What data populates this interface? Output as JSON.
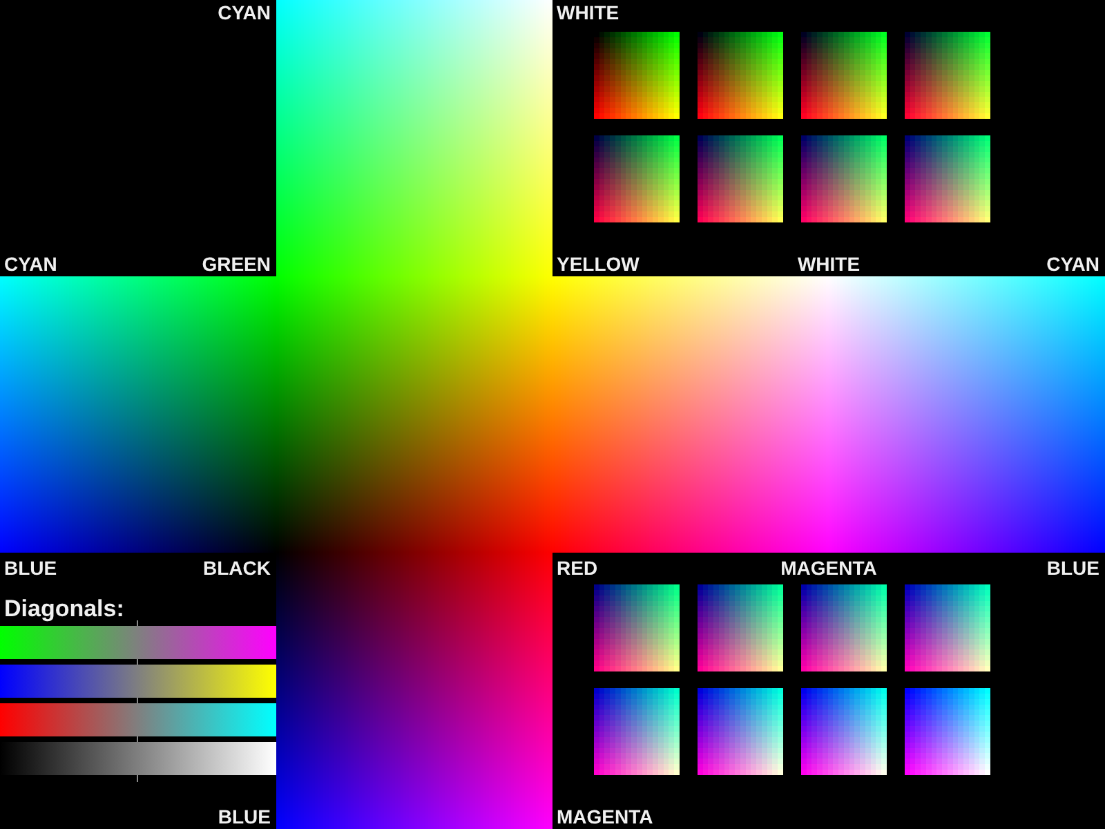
{
  "top_left_corner": {
    "top_right": "CYAN",
    "bottom_left": "CYAN",
    "bottom_right": "GREEN"
  },
  "top_right_corner": {
    "top_left": "WHITE",
    "bottom_left": "YELLOW",
    "bottom_center": "WHITE",
    "bottom_right": "CYAN"
  },
  "bottom_left_corner": {
    "top_left": "BLUE",
    "top_right": "BLACK",
    "heading": "Diagonals:",
    "bottom_right": "BLUE"
  },
  "bottom_right_corner": {
    "top_left": "RED",
    "top_center": "MAGENTA",
    "top_right": "BLUE",
    "bottom_left": "MAGENTA"
  }
}
